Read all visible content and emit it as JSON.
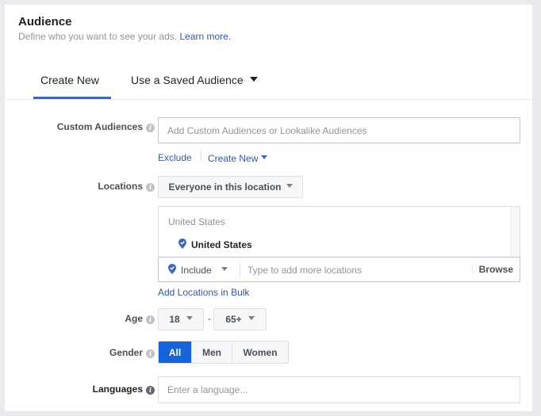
{
  "header": {
    "title": "Audience",
    "subtitle": "Define who you want to see your ads.",
    "learn_more": "Learn more."
  },
  "tabs": [
    {
      "label": "Create New",
      "active": true
    },
    {
      "label": "Use a Saved Audience",
      "active": false,
      "has_dropdown": true
    }
  ],
  "custom_audiences": {
    "label": "Custom Audiences",
    "placeholder": "Add Custom Audiences or Lookalike Audiences",
    "exclude_label": "Exclude",
    "create_new_label": "Create New"
  },
  "locations": {
    "label": "Locations",
    "scope_select": "Everyone in this location",
    "group_header": "United States",
    "selected_items": [
      "United States"
    ],
    "include_select": "Include",
    "search_placeholder": "Type to add more locations",
    "browse_label": "Browse",
    "bulk_link": "Add Locations in Bulk"
  },
  "age": {
    "label": "Age",
    "min": "18",
    "separator": "-",
    "max": "65+"
  },
  "gender": {
    "label": "Gender",
    "options": [
      "All",
      "Men",
      "Women"
    ],
    "selected": "All"
  },
  "languages": {
    "label": "Languages",
    "placeholder": "Enter a language..."
  },
  "colors": {
    "accent": "#4267b2",
    "link": "#365899",
    "selected_button": "#1664d9",
    "pin": "#4267b2"
  }
}
